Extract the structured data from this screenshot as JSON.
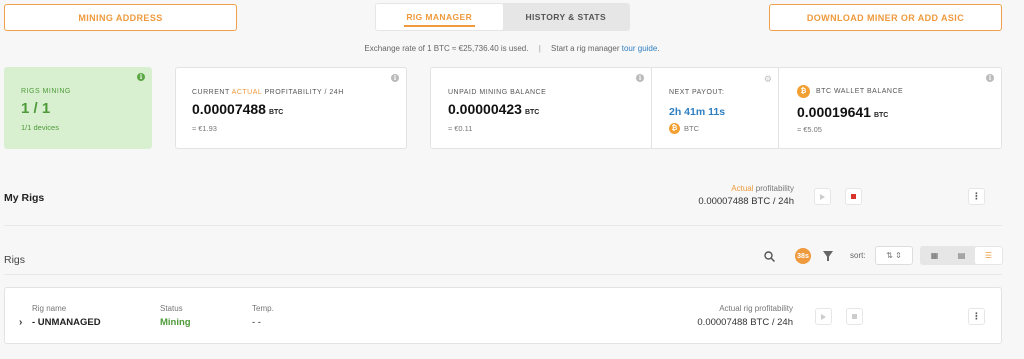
{
  "header": {
    "mining_address_label": "MINING ADDRESS",
    "download_label": "DOWNLOAD MINER OR ADD ASIC",
    "tabs": [
      {
        "label": "RIG MANAGER",
        "active": true
      },
      {
        "label": "HISTORY & STATS",
        "active": false
      }
    ]
  },
  "exchange": {
    "text": "Exchange rate of 1 BTC ≈ €25,736.40 is used.",
    "separator": "|",
    "tour_prefix": "Start a rig manager",
    "tour_link": "tour guide",
    "tour_suffix": "."
  },
  "stats": {
    "rigs_mining": {
      "label": "RIGS MINING",
      "count": "1 / 1",
      "devices": "1/1 devices"
    },
    "profitability": {
      "label_pre": "CURRENT",
      "label_accent": "ACTUAL",
      "label_post": "PROFITABILITY / 24H",
      "value": "0.00007488",
      "unit": "BTC",
      "fiat": "≈ €1.93"
    },
    "unpaid": {
      "label": "UNPAID MINING BALANCE",
      "value": "0.00000423",
      "unit": "BTC",
      "fiat": "≈ €0.11"
    },
    "next_payout": {
      "label": "NEXT PAYOUT:",
      "value": "2h 41m 11s",
      "currency": "BTC"
    },
    "wallet": {
      "label": "BTC WALLET BALANCE",
      "value": "0.00019641",
      "unit": "BTC",
      "fiat": "≈ €5.05"
    }
  },
  "my_rigs": {
    "title": "My Rigs",
    "profit_label_accent": "Actual",
    "profit_label": "profitability",
    "profit_value": "0.00007488 BTC / 24h"
  },
  "rigs_section": {
    "title": "Rigs",
    "refresh_badge": "38s",
    "sort_label": "sort:"
  },
  "rig_row": {
    "name_label": "Rig name",
    "name_value": "- UNMANAGED",
    "status_label": "Status",
    "status_value": "Mining",
    "temp_label": "Temp.",
    "temp_value": "- -",
    "profit_label": "Actual rig profitability",
    "profit_value": "0.00007488 BTC / 24h"
  },
  "colors": {
    "accent": "#ee9a3d",
    "green": "#4e9a3a",
    "link": "#2f7fc1",
    "stop": "#d9342b"
  }
}
